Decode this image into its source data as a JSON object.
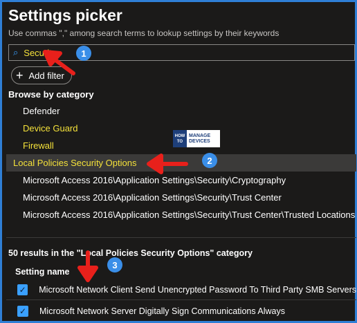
{
  "header": {
    "title": "Settings picker",
    "subtitle": "Use commas \",\" among search terms to lookup settings by their keywords"
  },
  "search": {
    "value": "Security",
    "icon": "search-icon"
  },
  "filter": {
    "add_label": "Add filter"
  },
  "browse": {
    "label": "Browse by category",
    "items": [
      {
        "label": "Defender"
      },
      {
        "label": "Device Guard"
      },
      {
        "label": "Firewall"
      },
      {
        "label": "Local Policies Security Options"
      },
      {
        "label": "Microsoft Access 2016\\Application Settings\\Security\\Cryptography"
      },
      {
        "label": "Microsoft Access 2016\\Application Settings\\Security\\Trust Center"
      },
      {
        "label": "Microsoft Access 2016\\Application Settings\\Security\\Trust Center\\Trusted Locations"
      }
    ]
  },
  "results": {
    "label": "50 results in the \"Local Policies Security Options\" category",
    "column_header": "Setting name",
    "rows": [
      {
        "label": "Microsoft Network Client Send Unencrypted Password To Third Party SMB Servers",
        "checked": true
      },
      {
        "label": "Microsoft Network Server Digitally Sign Communications Always",
        "checked": true
      }
    ]
  },
  "annotations": {
    "step1": "1",
    "step2": "2",
    "step3": "3"
  },
  "logo": {
    "line1": "HOW TO",
    "line2": "MANAGE",
    "line3": "DEVICES"
  },
  "colors": {
    "accent": "#3aa0ff",
    "highlight_text": "#f5e23a",
    "arrow": "#e8201b",
    "badge": "#3a8ee8",
    "frame_border": "#2f7fd6"
  }
}
